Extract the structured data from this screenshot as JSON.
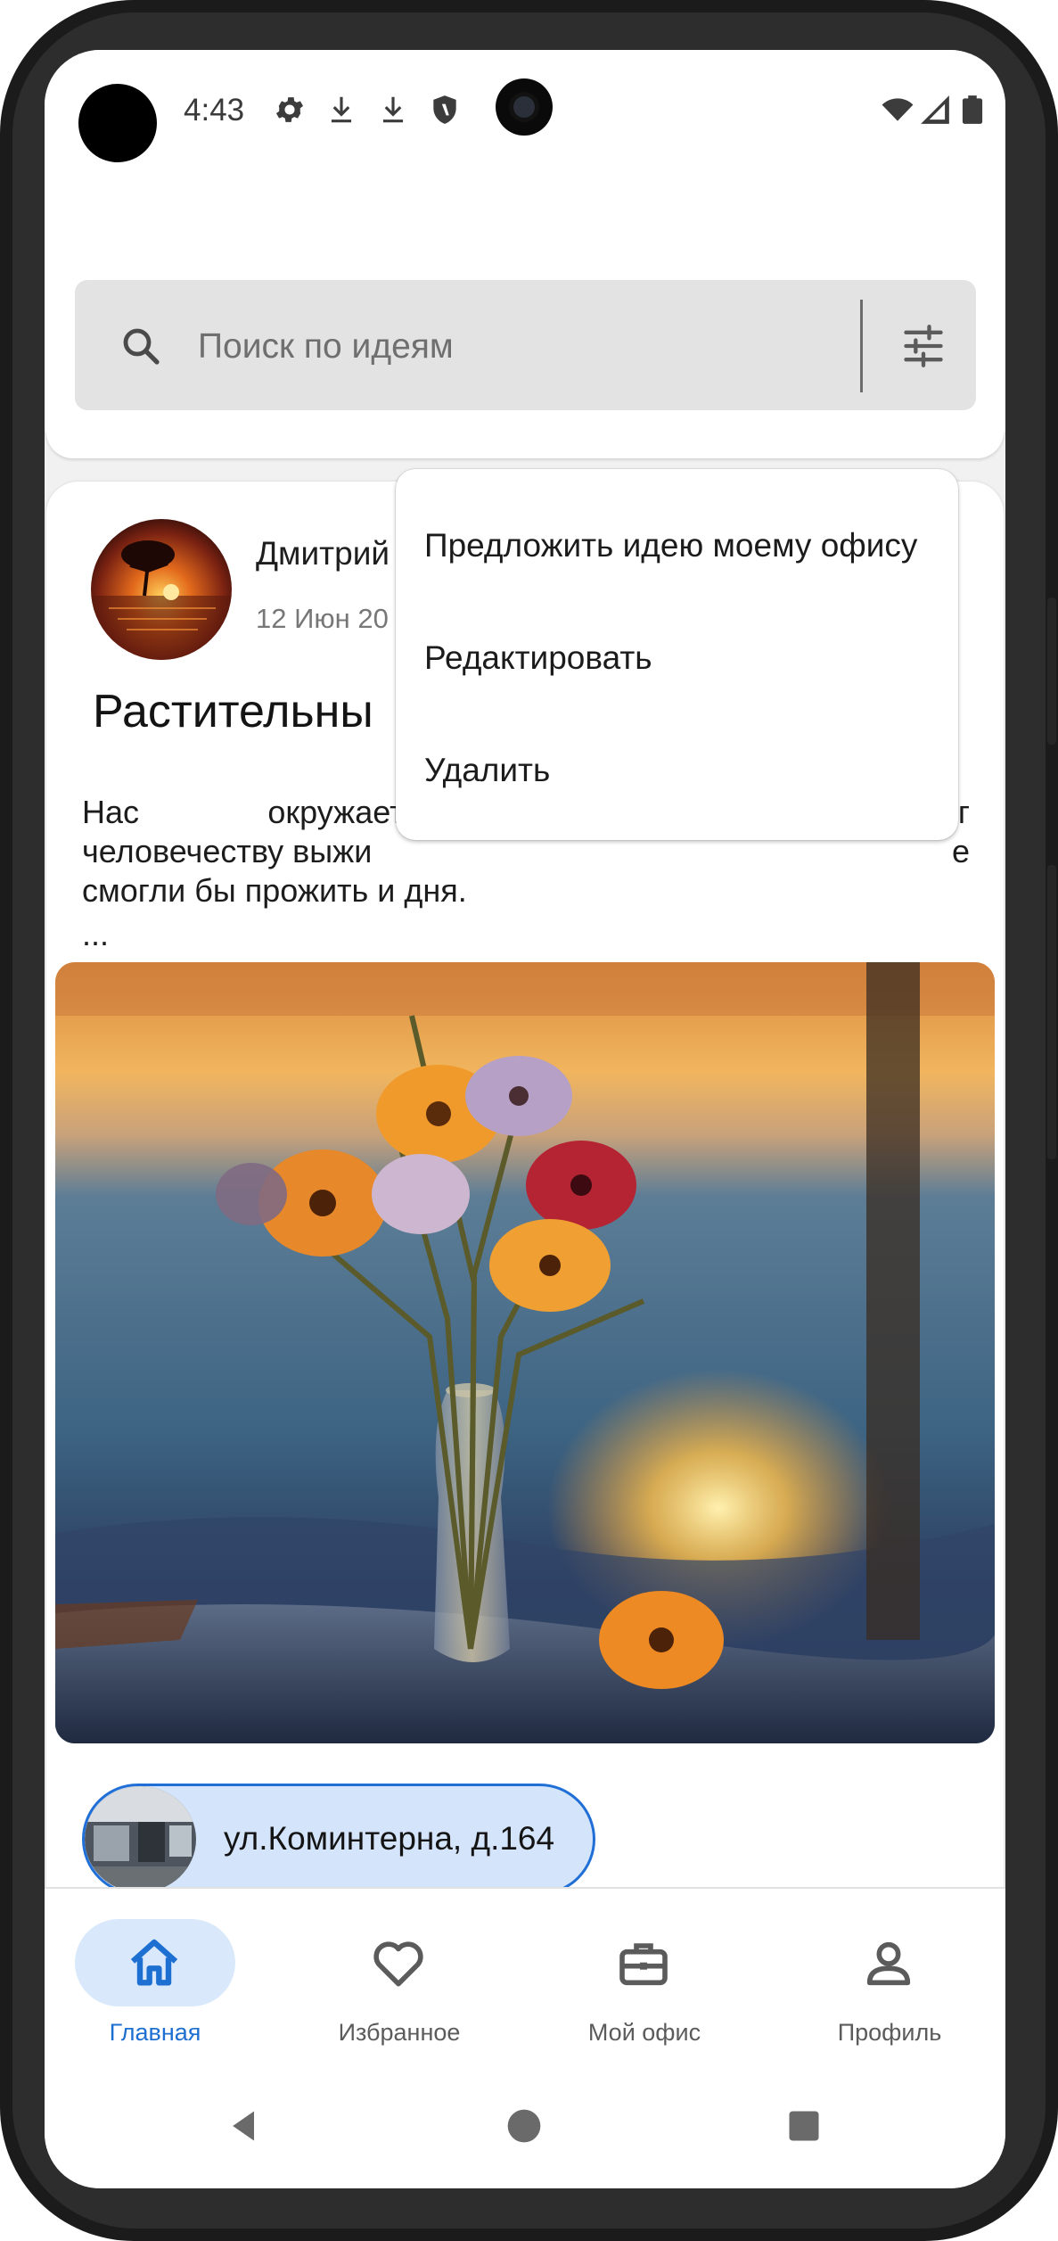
{
  "status_bar": {
    "time": "4:43",
    "icons": [
      "settings-icon",
      "download-icon",
      "download-icon",
      "shield-icon",
      "wifi-icon",
      "signal-icon",
      "battery-icon"
    ]
  },
  "search": {
    "placeholder": "Поиск по идеям"
  },
  "post": {
    "author": "Дмитрий",
    "date": "12 Июн 20",
    "title": "Растительны",
    "body": "Нас окружает ж... человечеству выжи... смогли бы прожить и дня.",
    "body_line1": "Нас окружает ж",
    "body_line2": "человечеству выжи",
    "body_line3": "смогли бы прожить и дня.",
    "body_line1_end": "г",
    "body_line2_end": "е",
    "ellipsis": "...",
    "office_chip": "ул.Коминтерна, д.164"
  },
  "menu": {
    "items": [
      {
        "label": "Предложить идею моему офису"
      },
      {
        "label": "Редактировать"
      },
      {
        "label": "Удалить"
      }
    ]
  },
  "bottom_nav": {
    "items": [
      {
        "label": "Главная",
        "icon": "home-icon",
        "active": true
      },
      {
        "label": "Избранное",
        "icon": "heart-icon",
        "active": false
      },
      {
        "label": "Мой офис",
        "icon": "briefcase-icon",
        "active": false
      },
      {
        "label": "Профиль",
        "icon": "person-icon",
        "active": false
      }
    ]
  },
  "colors": {
    "accent": "#1d6fd1",
    "chip_bg": "#d4e4fa",
    "nav_active_bg": "#d9e9fb"
  }
}
